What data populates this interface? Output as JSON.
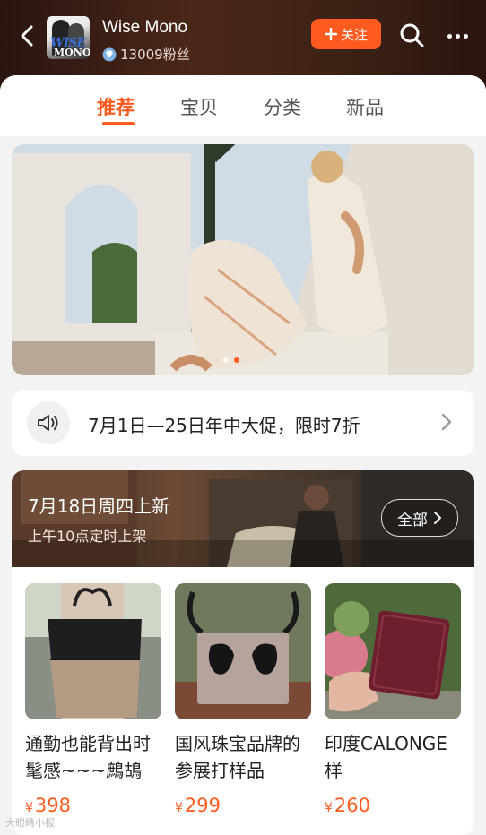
{
  "header": {
    "shop_name": "Wise Mono",
    "logo_text_1": "WISE",
    "logo_text_2": "MONO",
    "fans": "13009粉丝",
    "follow_label": "关注",
    "icons": [
      "back-icon",
      "search-icon",
      "more-icon",
      "diamond-icon",
      "plus-icon"
    ]
  },
  "tabs": [
    {
      "label": "推荐",
      "active": true
    },
    {
      "label": "宝贝",
      "active": false
    },
    {
      "label": "分类",
      "active": false
    },
    {
      "label": "新品",
      "active": false
    }
  ],
  "banner": {
    "dot_count": 2,
    "active_dot": 1
  },
  "notice": {
    "text": "7月1日—25日年中大促，限时7折"
  },
  "new_arrivals": {
    "title": "7月18日周四上新",
    "subtitle": "上午10点定时上架",
    "all_label": "全部"
  },
  "products": [
    {
      "title": "通勤也能背出时髦感~~~鷓鴣",
      "currency": "¥",
      "price": "398"
    },
    {
      "title": "国风珠宝品牌的参展打样品",
      "currency": "¥",
      "price": "299"
    },
    {
      "title": "印度CALONGE样",
      "currency": "¥",
      "price": "260"
    }
  ],
  "watermark": "大眼睛小报",
  "colors": {
    "accent": "#ff5a1f",
    "header_bg": "#3a2014"
  }
}
